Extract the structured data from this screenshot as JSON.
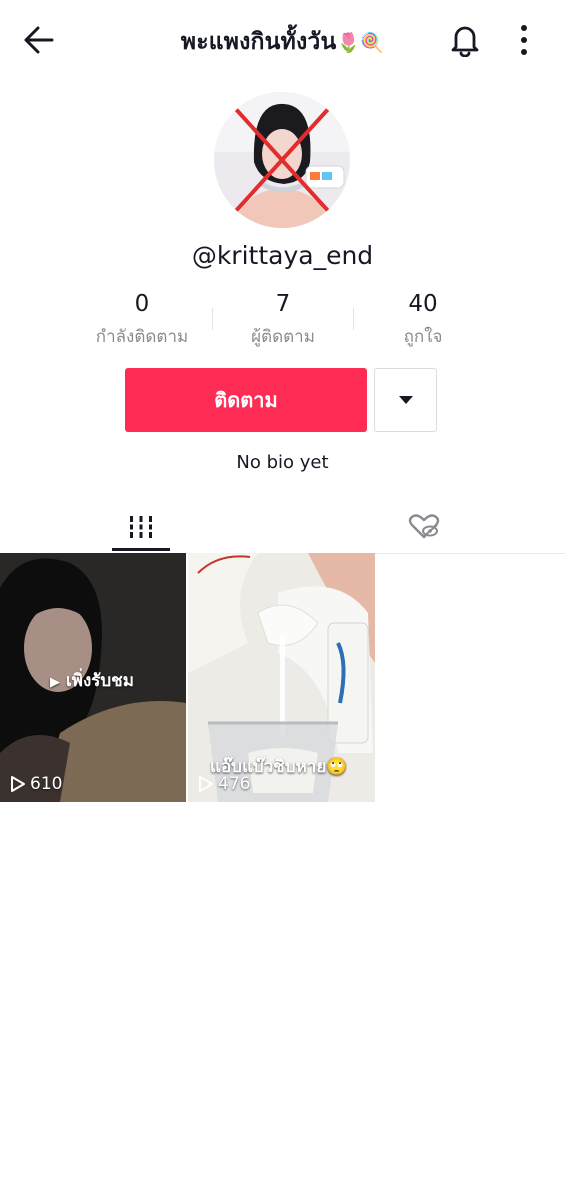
{
  "header": {
    "title": "พะแพงกินทั้งวัน",
    "title_emojis": "🌷🍭",
    "back_icon": "arrow-left-icon",
    "bell_icon": "bell-icon",
    "more_icon": "more-vertical-icon"
  },
  "profile": {
    "username": "@krittaya_end",
    "bio": "No bio yet"
  },
  "stats": [
    {
      "value": "0",
      "label": "กำลังติดตาม"
    },
    {
      "value": "7",
      "label": "ผู้ติดตาม"
    },
    {
      "value": "40",
      "label": "ถูกใจ"
    }
  ],
  "actions": {
    "follow_label": "ติดตาม",
    "dropdown_icon": "caret-down-icon"
  },
  "tabs": [
    {
      "name": "videos",
      "icon": "grid-bars-icon",
      "active": true
    },
    {
      "name": "liked",
      "icon": "heart-eye-slash-icon",
      "active": false
    }
  ],
  "videos": [
    {
      "overlay_text": "เพิ่งรับชม",
      "views": "610"
    },
    {
      "overlay_text": "แอ๊บแบ๊วชิบหาย🙄",
      "views": "476"
    }
  ],
  "colors": {
    "accent": "#fe2c55",
    "text": "#161823",
    "muted": "#8a8b91"
  }
}
